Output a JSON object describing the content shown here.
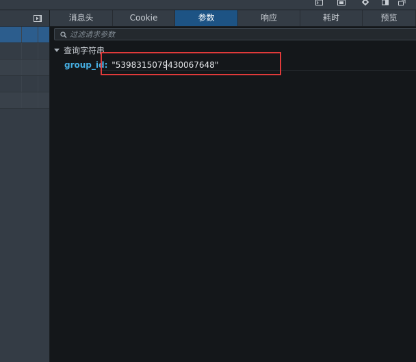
{
  "tabs": [
    {
      "label": "消息头",
      "active": false
    },
    {
      "label": "Cookie",
      "active": false
    },
    {
      "label": "参数",
      "active": true
    },
    {
      "label": "响应",
      "active": false
    },
    {
      "label": "耗时",
      "active": false
    },
    {
      "label": "预览",
      "active": false
    }
  ],
  "filter": {
    "placeholder": "过滤请求参数"
  },
  "section": {
    "title": "查询字符串"
  },
  "params": [
    {
      "key": "group_id",
      "value": "\"5398315079430067648\""
    }
  ],
  "colors": {
    "accent_tab": "#1d5384",
    "selected_row": "#2c5d8d",
    "param_key": "#46afe3",
    "highlight_box": "#e03a3a",
    "panel_bg": "#14171a",
    "toolbar_bg": "#343c45"
  },
  "icons": [
    "console-icon",
    "screenshot-icon",
    "settings-icon",
    "dock-icon",
    "popout-icon",
    "collapse-pane-icon",
    "search-icon",
    "disclosure-triangle-icon"
  ]
}
